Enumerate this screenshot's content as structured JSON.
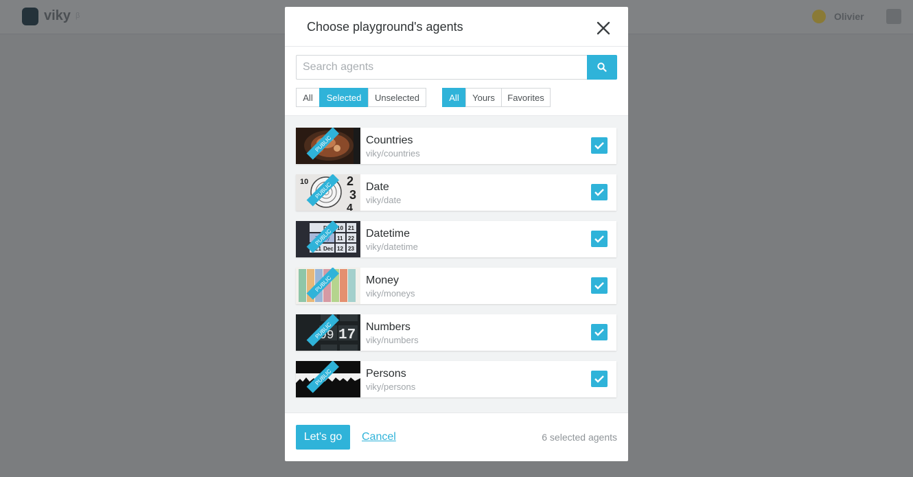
{
  "app": {
    "name": "viky",
    "beta": "β",
    "user": "Olivier"
  },
  "modal": {
    "title": "Choose playground's agents",
    "search": {
      "placeholder": "Search agents",
      "value": ""
    },
    "selection_filter": {
      "options": [
        "All",
        "Selected",
        "Unselected"
      ],
      "active": "Selected"
    },
    "scope_filter": {
      "options": [
        "All",
        "Yours",
        "Favorites"
      ],
      "active": "All"
    },
    "agents": [
      {
        "name": "Countries",
        "slug": "viky/countries",
        "badge": "PUBLIC",
        "checked": true,
        "thumb": "food-pan"
      },
      {
        "name": "Date",
        "slug": "viky/date",
        "badge": "PUBLIC",
        "checked": true,
        "thumb": "clock"
      },
      {
        "name": "Datetime",
        "slug": "viky/datetime",
        "badge": "PUBLIC",
        "checked": true,
        "thumb": "calendar"
      },
      {
        "name": "Money",
        "slug": "viky/moneys",
        "badge": "PUBLIC",
        "checked": true,
        "thumb": "banknotes"
      },
      {
        "name": "Numbers",
        "slug": "viky/numbers",
        "badge": "PUBLIC",
        "checked": true,
        "thumb": "flip-numbers"
      },
      {
        "name": "Persons",
        "slug": "viky/persons",
        "badge": "PUBLIC",
        "checked": true,
        "thumb": "crowd"
      }
    ],
    "footer": {
      "confirm_label": "Let's go",
      "cancel_label": "Cancel",
      "selected_count": "6 selected agents"
    }
  },
  "thumb_text": {
    "clock_digits": [
      "10",
      "2",
      "3",
      "4"
    ],
    "calendar_cells": [
      "Dec",
      "10",
      "21",
      "Today",
      "11",
      "22",
      "21",
      "Dec",
      "12",
      "23"
    ],
    "flip_digits": [
      "09",
      "17"
    ]
  },
  "colors": {
    "accent": "#2fb3d9",
    "overlay": "#7b7d7f"
  }
}
